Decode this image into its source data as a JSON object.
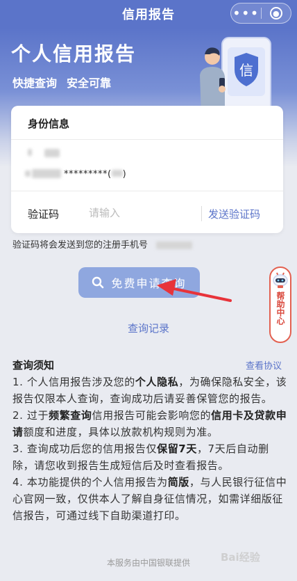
{
  "navbar": {
    "title": "信用报告",
    "more_icon": "•••",
    "close_icon": "⊗"
  },
  "hero": {
    "title": "个人信用报告",
    "tag1": "快捷查询",
    "tag2": "安全可靠",
    "badge_char": "信"
  },
  "card": {
    "title": "身份信息",
    "id_masked": "*********(",
    "id_suffix": ")",
    "verify_label": "验证码",
    "verify_placeholder": "请输入",
    "send_button": "发送验证码"
  },
  "notice_line": "验证码将会发送到您的注册手机号",
  "query_button": "免费申请查询",
  "records_link": "查询记录",
  "help": {
    "label": "帮助中心"
  },
  "notice": {
    "title": "查询须知",
    "agreement_link": "查看协议",
    "items": [
      {
        "parts": [
          {
            "t": "1. 个人信用报告涉及您的"
          },
          {
            "t": "个人隐私",
            "b": true
          },
          {
            "t": "，为确保隐私安全，该报告仅限本人查询，查询成功后请妥善保管您的报告。"
          }
        ]
      },
      {
        "parts": [
          {
            "t": "2. 过于"
          },
          {
            "t": "频繁查询",
            "b": true
          },
          {
            "t": "信用报告可能会影响您的"
          },
          {
            "t": "信用卡及贷款申请",
            "b": true
          },
          {
            "t": "额度和进度，具体以放款机构规则为准。"
          }
        ]
      },
      {
        "parts": [
          {
            "t": "3. 查询成功后您的信用报告仅"
          },
          {
            "t": "保留7天",
            "b": true
          },
          {
            "t": "，7天后自动删除，请您收到报告生成短信后及时查看报告。"
          }
        ]
      },
      {
        "parts": [
          {
            "t": "4. 本功能提供的个人信用报告为"
          },
          {
            "t": "简版",
            "b": true
          },
          {
            "t": "，与人民银行征信中心官网一致，仅供本人了解自身征信情况，如需详细版征信报告，可通过线下自助渠道打印。"
          }
        ]
      }
    ]
  },
  "footer": "本服务由中国银联提供",
  "watermark": "Bai经验",
  "colors": {
    "brand": "#5b74c9",
    "button": "#8fa7df",
    "annotation_arrow": "#e8333a",
    "help_border": "#e36050"
  }
}
